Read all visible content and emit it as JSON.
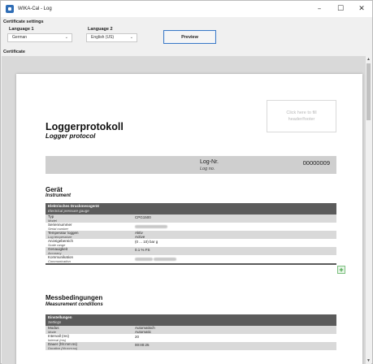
{
  "window": {
    "title": "WIKA-Cal - Log",
    "minimize": "–",
    "maximize": "☐",
    "close": "✕"
  },
  "settings": {
    "section_label": "Certificate settings",
    "language1_label": "Language 1",
    "language1_value": "German",
    "language2_label": "Language 2",
    "language2_value": "English (US)",
    "preview_label": "Preview"
  },
  "certificate": {
    "section_label": "Certificate",
    "title_de": "Loggerprotokoll",
    "title_en": "Logger protocol",
    "header_box": "Click here to fill header/footer",
    "log_no_de": "Log-Nr.",
    "log_no_en": "Log no.",
    "log_no_value": "00000009",
    "instrument": {
      "title_de": "Gerät",
      "title_en": "Instrument",
      "table_head_de": "Elektrisches Druckmessgerät",
      "table_head_en": "Electrical pressure gauge",
      "rows": [
        {
          "de": "Typ",
          "en": "Model",
          "value": "CPG1500"
        },
        {
          "de": "Seriennummer",
          "en": "Serial number",
          "value": ""
        },
        {
          "de": "Temperatur loggen",
          "en": "Log temperature",
          "value": "Aktiv",
          "value2": "Active"
        },
        {
          "de": "Anzeigebereich",
          "en": "Scale range",
          "value": "(0 ... 10) bar g"
        },
        {
          "de": "Genauigkeit",
          "en": "Accuracy",
          "value": "0.1 % FS"
        },
        {
          "de": "Kommunikation",
          "en": "Communication",
          "value": ""
        }
      ]
    },
    "conditions": {
      "title_de": "Messbedingungen",
      "title_en": "Measurement conditions",
      "table_head_de": "Einstellungen",
      "table_head_en": "Settings",
      "rows": [
        {
          "de": "Modus",
          "en": "Mode",
          "value": "Automatisch",
          "value2": "Automatic"
        },
        {
          "de": "Intervall (ms)",
          "en": "Interval (ms)",
          "value": "20"
        },
        {
          "de": "Dauer (hh:mm:ss)",
          "en": "Duration (hh:mm:ss)",
          "value": "00:00:25"
        }
      ]
    }
  },
  "icons": {
    "add": "+",
    "scroll_up": "▲",
    "scroll_down": "▼",
    "chevron": "⌄"
  }
}
